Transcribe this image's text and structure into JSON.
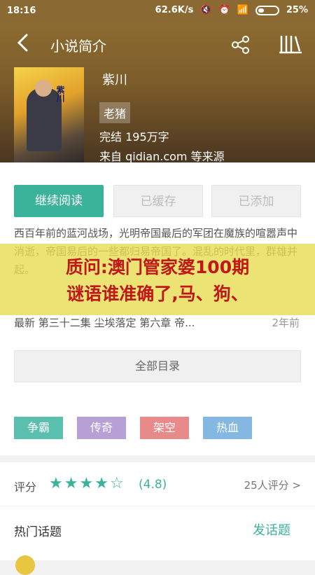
{
  "status_bar": {
    "time": "18:16",
    "network_speed": "62.6K/s",
    "battery": "25%"
  },
  "toolbar": {
    "title": "小说简介",
    "back_icon": "back-arrow-icon",
    "share_icon": "share-icon",
    "shelf_icon": "bookshelf-icon"
  },
  "book": {
    "title": "紫川",
    "author": "老猪",
    "status_and_count": "完结  195万字",
    "source": "来自 qidian.com 等来源"
  },
  "actions": {
    "read": "继续阅读",
    "cached": "已缓存",
    "added": "已添加"
  },
  "description": "西百年前的蓝河战场，光明帝国最后的军团在魔族的喧嚣声中消逝，帝国易后的一些都归易帝国了。混乱的时代里，群雄并起。",
  "banner": {
    "line1": "质问:澳门管家婆100期",
    "line2": "谜语谁准确了,马、狗、"
  },
  "latest": {
    "text": "最新 第三十二集 尘埃落定 第六章 帝...",
    "time": "2年前"
  },
  "toc_label": "全部目录",
  "tags": [
    {
      "label": "争霸",
      "color": "#5bbfb0"
    },
    {
      "label": "传奇",
      "color": "#b7a0d6"
    },
    {
      "label": "架空",
      "color": "#e88a8a"
    },
    {
      "label": "热血",
      "color": "#84b8e3"
    }
  ],
  "rating": {
    "label": "评分",
    "stars": 4.5,
    "score": "(4.8)",
    "raters": "25人评分 >"
  },
  "hot_topics": {
    "label": "热门话题",
    "post": "发话题"
  }
}
